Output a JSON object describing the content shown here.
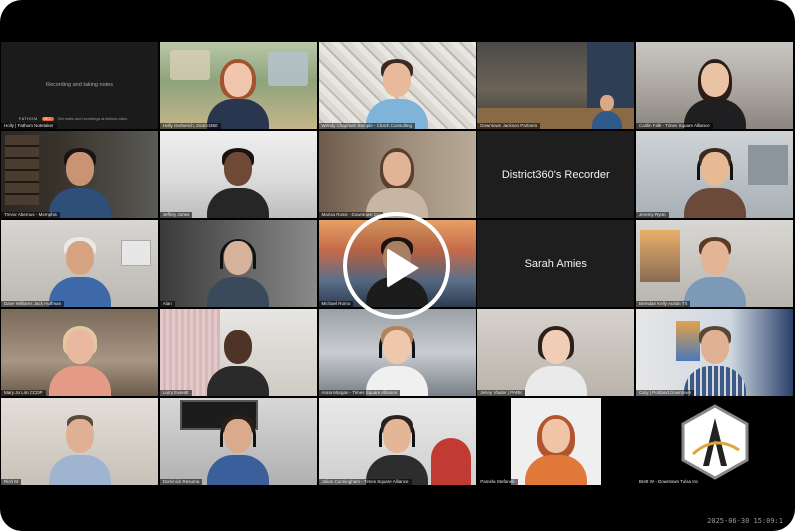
{
  "recording_tile": {
    "message": "Recording and taking notes",
    "brand": "FATHOM",
    "badge": "REC",
    "sub_text": "Get notes and recordings at fathom.video"
  },
  "recorder_tile": {
    "label": "District360's Recorder"
  },
  "audio_tile": {
    "label": "Sarah Amies"
  },
  "participants": [
    "Holly | Fathom Notetaker",
    "Holly Gerberich, District360",
    "Wendy Chapman Semple - Clutch Consulting",
    "Downtown Jackson Partners",
    "Caitlin Falk - Times Square Alliance",
    "Trevor Abernus - Memphis",
    "Jeffrey Jones",
    "Marisa Rossi - Downtown Co",
    "Jeremy Rynn",
    "Dave Williams Jack Huffman",
    "Alan",
    "Michael Romo",
    "Brendan Kelly Austin TX",
    "Mary Jo Lim CCDP",
    "Larry Everett",
    "Anna Morgan - Times Square Alliance",
    "Jenny Vlader | PARK",
    "Cary | Portland Downtown",
    "Rich M",
    "Dominick Resuma",
    "Julian Cunningham - Times Square Alliance",
    "Pamela Stefanek",
    "Brett W - Downtown Tulsa Inc"
  ],
  "player": {
    "play_label": "Play video",
    "timestamp": "2025-06-30 15:09:1"
  },
  "colors": {
    "background": "#000000",
    "tile_dark": "#1e1e1e",
    "namebar": "rgba(0,0,0,0.55)",
    "play": "#ffffff"
  }
}
